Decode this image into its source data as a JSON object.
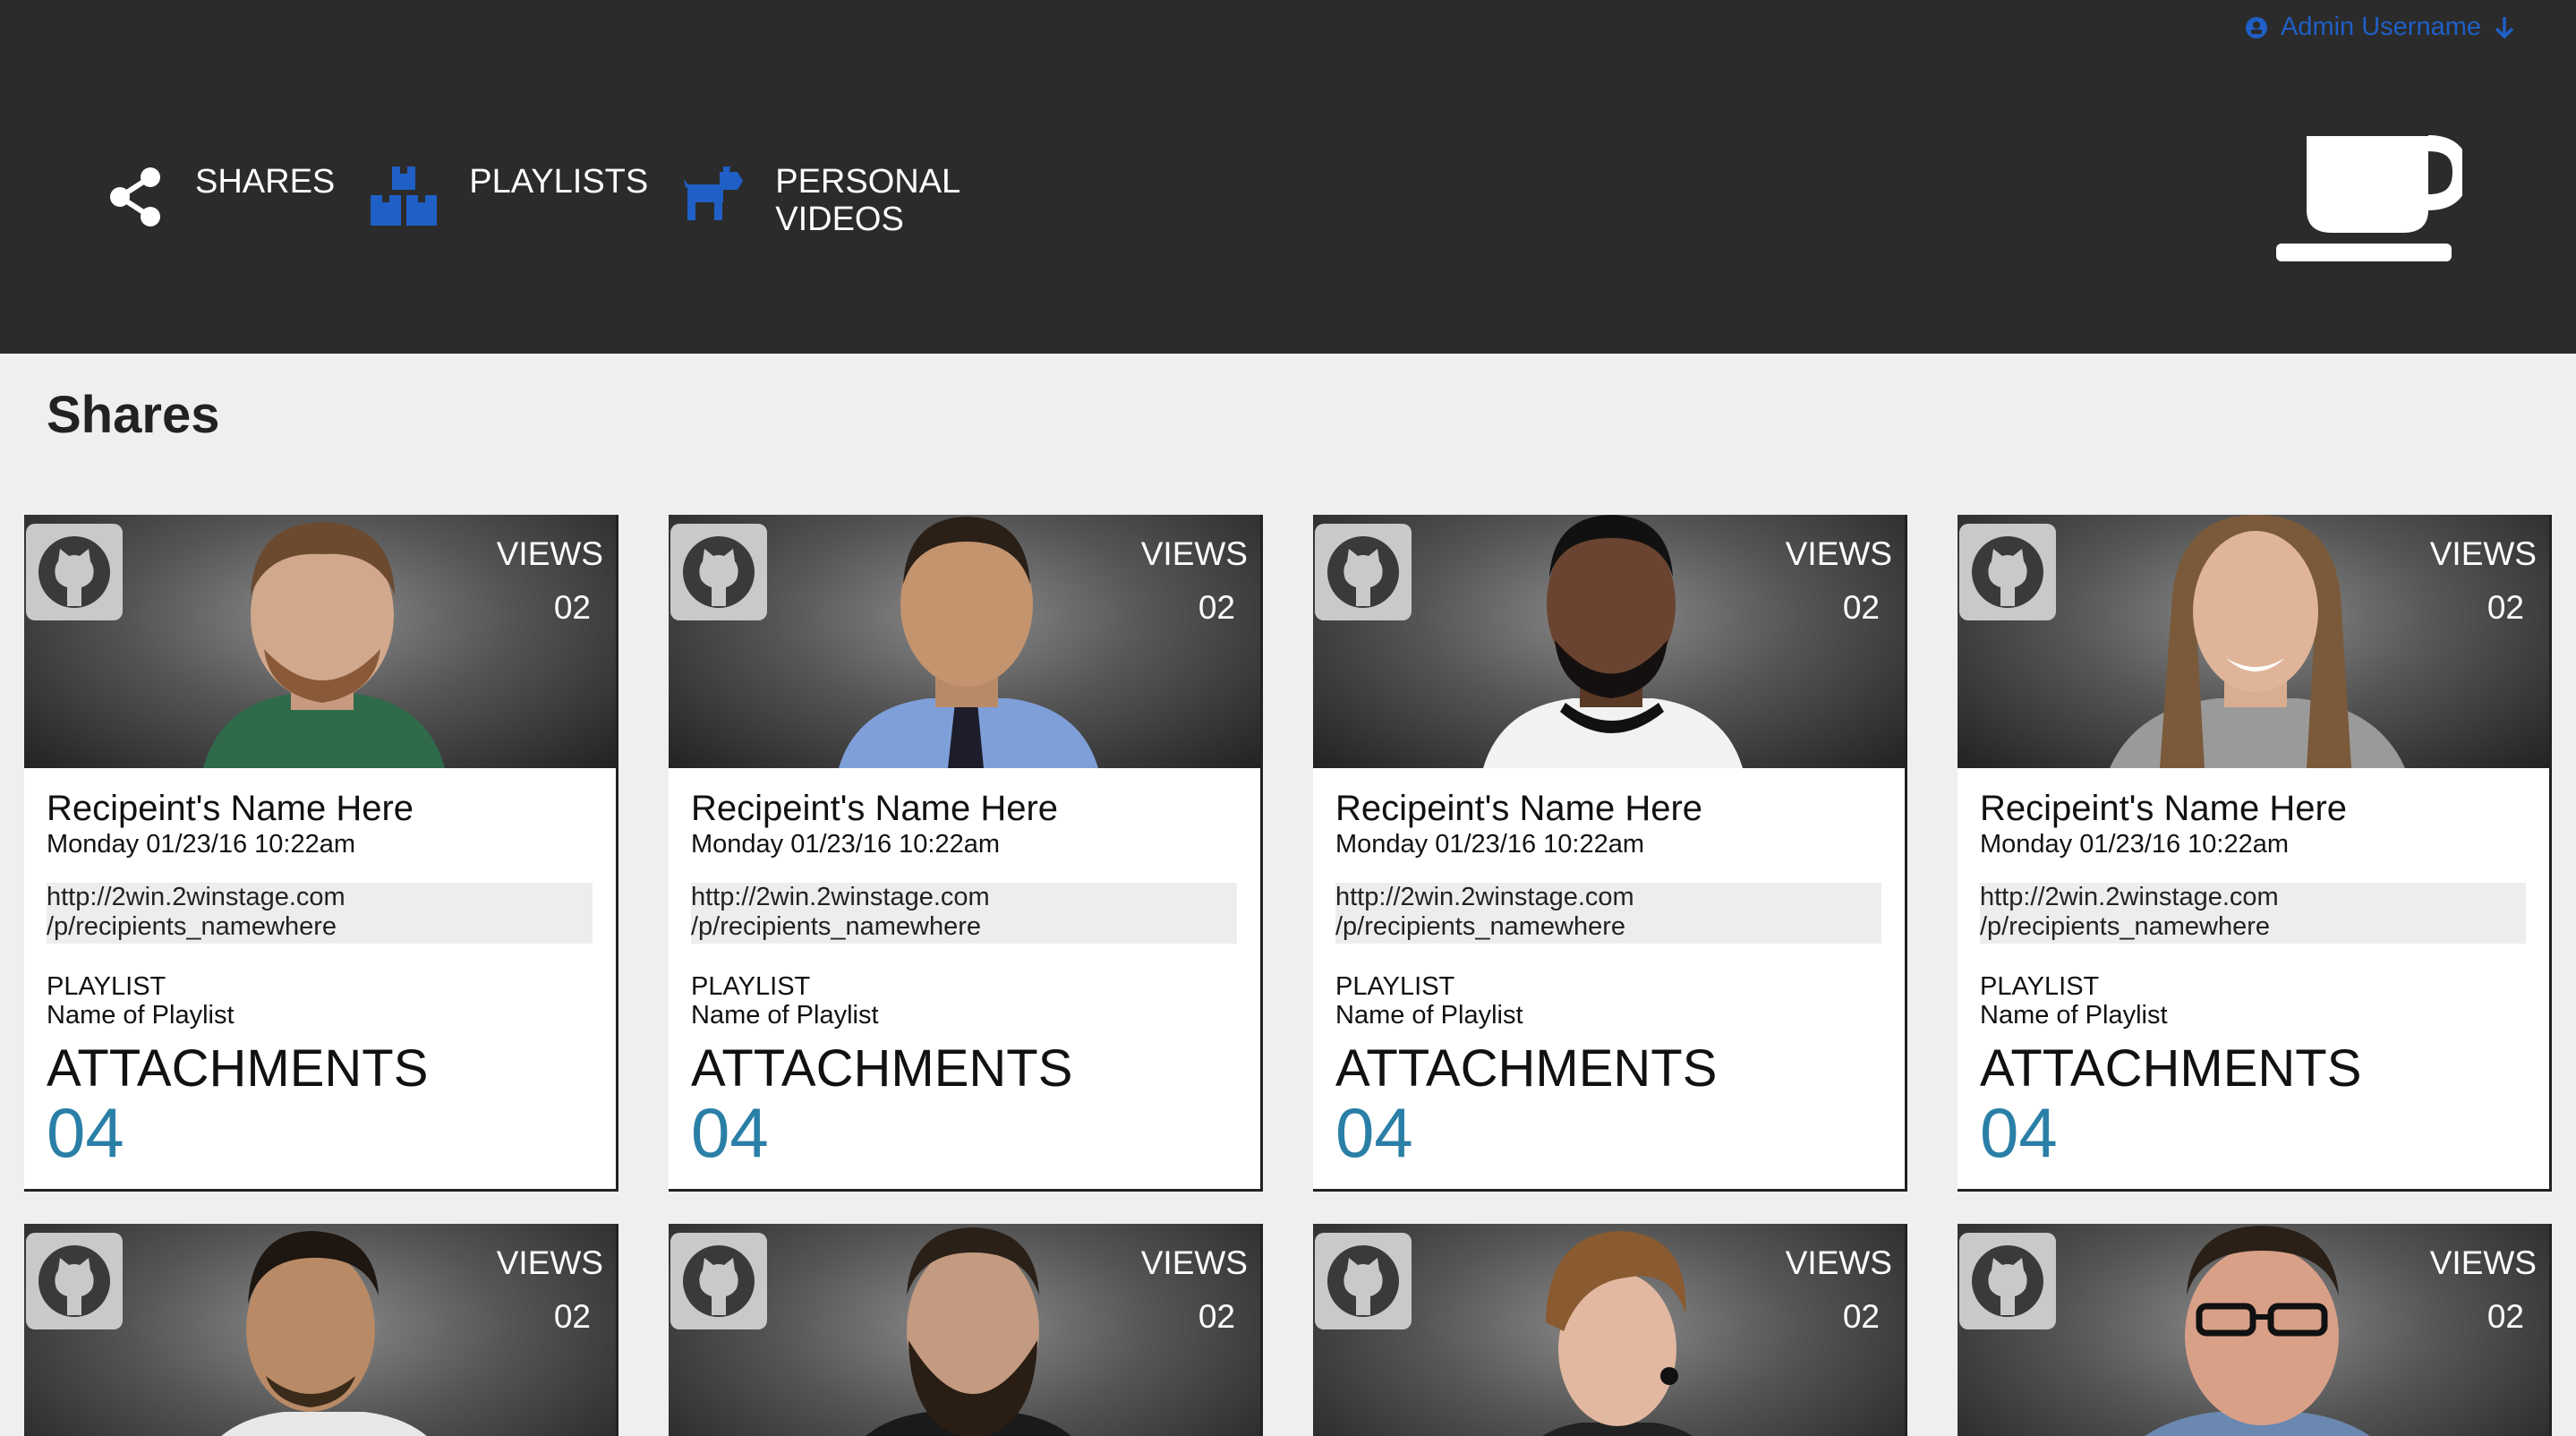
{
  "header": {
    "admin_label": "Admin Username",
    "nav": [
      {
        "label": "SHARES",
        "icon": "share-icon"
      },
      {
        "label": "PLAYLISTS",
        "icon": "boxes-icon"
      },
      {
        "label": "PERSONAL VIDEOS",
        "icon": "dog-icon"
      }
    ],
    "logo_icon": "coffee-cup-icon",
    "accent_color": "#1f5fc6"
  },
  "main": {
    "title": "Shares",
    "views_label": "VIEWS",
    "playlist_label": "PLAYLIST",
    "attachments_label": "ATTACHMENTS",
    "cards": [
      {
        "views": "02",
        "name": "Recipeint's Name Here",
        "date": "Monday 01/23/16 10:22am",
        "url_1": "http://2win.2winstage.com",
        "url_2": "/p/recipients_namewhere",
        "playlist": "Name of Playlist",
        "attachments": "04"
      },
      {
        "views": "02",
        "name": "Recipeint's Name Here",
        "date": "Monday 01/23/16 10:22am",
        "url_1": "http://2win.2winstage.com",
        "url_2": "/p/recipients_namewhere",
        "playlist": "Name of Playlist",
        "attachments": "04"
      },
      {
        "views": "02",
        "name": "Recipeint's Name Here",
        "date": "Monday 01/23/16 10:22am",
        "url_1": "http://2win.2winstage.com",
        "url_2": "/p/recipients_namewhere",
        "playlist": "Name of Playlist",
        "attachments": "04"
      },
      {
        "views": "02",
        "name": "Recipeint's Name Here",
        "date": "Monday 01/23/16 10:22am",
        "url_1": "http://2win.2winstage.com",
        "url_2": "/p/recipients_namewhere",
        "playlist": "Name of Playlist",
        "attachments": "04"
      },
      {
        "views": "02"
      },
      {
        "views": "02"
      },
      {
        "views": "02"
      },
      {
        "views": "02"
      }
    ],
    "attachments_color": "#2a7fa6"
  }
}
